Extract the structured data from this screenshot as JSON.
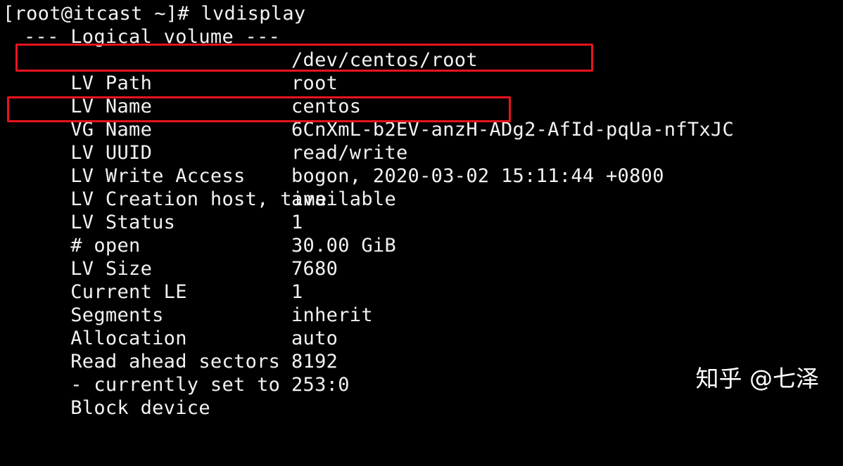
{
  "terminal": {
    "prompt": "[root@itcast ~]# lvdisplay",
    "header": "--- Logical volume ---",
    "fields": [
      {
        "label": "LV Path",
        "value": "/dev/centos/root"
      },
      {
        "label": "LV Name",
        "value": "root"
      },
      {
        "label": "VG Name",
        "value": "centos"
      },
      {
        "label": "LV UUID",
        "value": "6CnXmL-b2EV-anzH-ADg2-AfId-pqUa-nfTxJC"
      },
      {
        "label": "LV Write Access",
        "value": "read/write"
      },
      {
        "label": "LV Creation host, time",
        "value": "bogon, 2020-03-02 15:11:44 +0800"
      },
      {
        "label": "LV Status",
        "value": "available"
      },
      {
        "label": "# open",
        "value": "1"
      },
      {
        "label": "LV Size",
        "value": "30.00 GiB"
      },
      {
        "label": "Current LE",
        "value": "7680"
      },
      {
        "label": "Segments",
        "value": "1"
      },
      {
        "label": "Allocation",
        "value": "inherit"
      },
      {
        "label": "Read ahead sectors",
        "value": "auto"
      },
      {
        "label": "- currently set to",
        "value": "8192"
      },
      {
        "label": "Block device",
        "value": "253:0"
      }
    ]
  },
  "watermark": "知乎 @七泽",
  "colors": {
    "background": "#000000",
    "text": "#f2f2f2",
    "highlight": "#e8141c"
  }
}
